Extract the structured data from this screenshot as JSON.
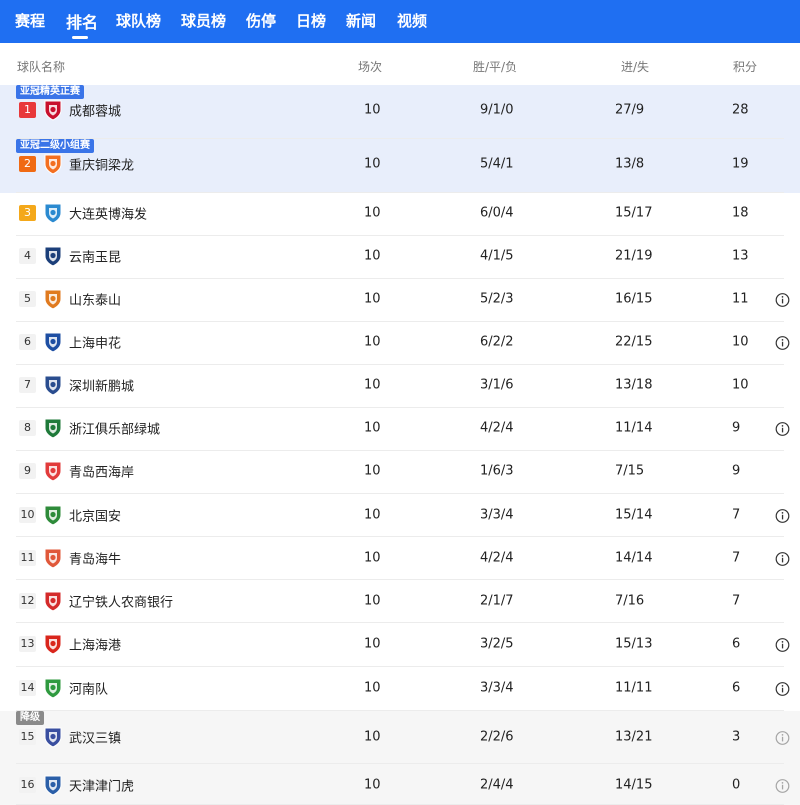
{
  "nav": {
    "tabs": [
      {
        "label": "赛程",
        "active": false
      },
      {
        "label": "排名",
        "active": true
      },
      {
        "label": "球队榜",
        "active": false
      },
      {
        "label": "球员榜",
        "active": false
      },
      {
        "label": "伤停",
        "active": false
      },
      {
        "label": "日榜",
        "active": false
      },
      {
        "label": "新闻",
        "active": false
      },
      {
        "label": "视频",
        "active": false
      }
    ]
  },
  "table": {
    "headers": {
      "team": "球队名称",
      "played": "场次",
      "wdl": "胜/平/负",
      "goals": "进/失",
      "points": "积分"
    },
    "zones": {
      "acl_elite": "亚冠精英正赛",
      "acl_two": "亚冠二级小组赛",
      "relegation": "降级"
    },
    "rows": [
      {
        "rank": "1",
        "team": "成都蓉城",
        "played": "10",
        "wdl": "9/1/0",
        "goals": "27/9",
        "points": "28",
        "info": false,
        "logo_color": "#c8102e"
      },
      {
        "rank": "2",
        "team": "重庆铜梁龙",
        "played": "10",
        "wdl": "5/4/1",
        "goals": "13/8",
        "points": "19",
        "info": false,
        "logo_color": "#f36f21"
      },
      {
        "rank": "3",
        "team": "大连英博海发",
        "played": "10",
        "wdl": "6/0/4",
        "goals": "15/17",
        "points": "18",
        "info": false,
        "logo_color": "#2b8ad0"
      },
      {
        "rank": "4",
        "team": "云南玉昆",
        "played": "10",
        "wdl": "4/1/5",
        "goals": "21/19",
        "points": "13",
        "info": false,
        "logo_color": "#1c3f7a"
      },
      {
        "rank": "5",
        "team": "山东泰山",
        "played": "10",
        "wdl": "5/2/3",
        "goals": "16/15",
        "points": "11",
        "info": true,
        "logo_color": "#e07a1f"
      },
      {
        "rank": "6",
        "team": "上海申花",
        "played": "10",
        "wdl": "6/2/2",
        "goals": "22/15",
        "points": "10",
        "info": true,
        "logo_color": "#1e4fa3"
      },
      {
        "rank": "7",
        "team": "深圳新鹏城",
        "played": "10",
        "wdl": "3/1/6",
        "goals": "13/18",
        "points": "10",
        "info": false,
        "logo_color": "#2a4d8f"
      },
      {
        "rank": "8",
        "team": "浙江俱乐部绿城",
        "played": "10",
        "wdl": "4/2/4",
        "goals": "11/14",
        "points": "9",
        "info": true,
        "logo_color": "#1f7a3a"
      },
      {
        "rank": "9",
        "team": "青岛西海岸",
        "played": "10",
        "wdl": "1/6/3",
        "goals": "7/15",
        "points": "9",
        "info": false,
        "logo_color": "#e23b3b"
      },
      {
        "rank": "10",
        "team": "北京国安",
        "played": "10",
        "wdl": "3/3/4",
        "goals": "15/14",
        "points": "7",
        "info": true,
        "logo_color": "#2e8b3a"
      },
      {
        "rank": "11",
        "team": "青岛海牛",
        "played": "10",
        "wdl": "4/2/4",
        "goals": "14/14",
        "points": "7",
        "info": true,
        "logo_color": "#e0583a"
      },
      {
        "rank": "12",
        "team": "辽宁铁人农商银行",
        "played": "10",
        "wdl": "2/1/7",
        "goals": "7/16",
        "points": "7",
        "info": false,
        "logo_color": "#d42a2a"
      },
      {
        "rank": "13",
        "team": "上海海港",
        "played": "10",
        "wdl": "3/2/5",
        "goals": "15/13",
        "points": "6",
        "info": true,
        "logo_color": "#d9261c"
      },
      {
        "rank": "14",
        "team": "河南队",
        "played": "10",
        "wdl": "3/3/4",
        "goals": "11/11",
        "points": "6",
        "info": true,
        "logo_color": "#2f9a3f"
      },
      {
        "rank": "15",
        "team": "武汉三镇",
        "played": "10",
        "wdl": "2/2/6",
        "goals": "13/21",
        "points": "3",
        "info": true,
        "logo_color": "#3a4fa0"
      },
      {
        "rank": "16",
        "team": "天津津门虎",
        "played": "10",
        "wdl": "2/4/4",
        "goals": "14/15",
        "points": "0",
        "info": true,
        "logo_color": "#2b5fa8"
      }
    ]
  }
}
